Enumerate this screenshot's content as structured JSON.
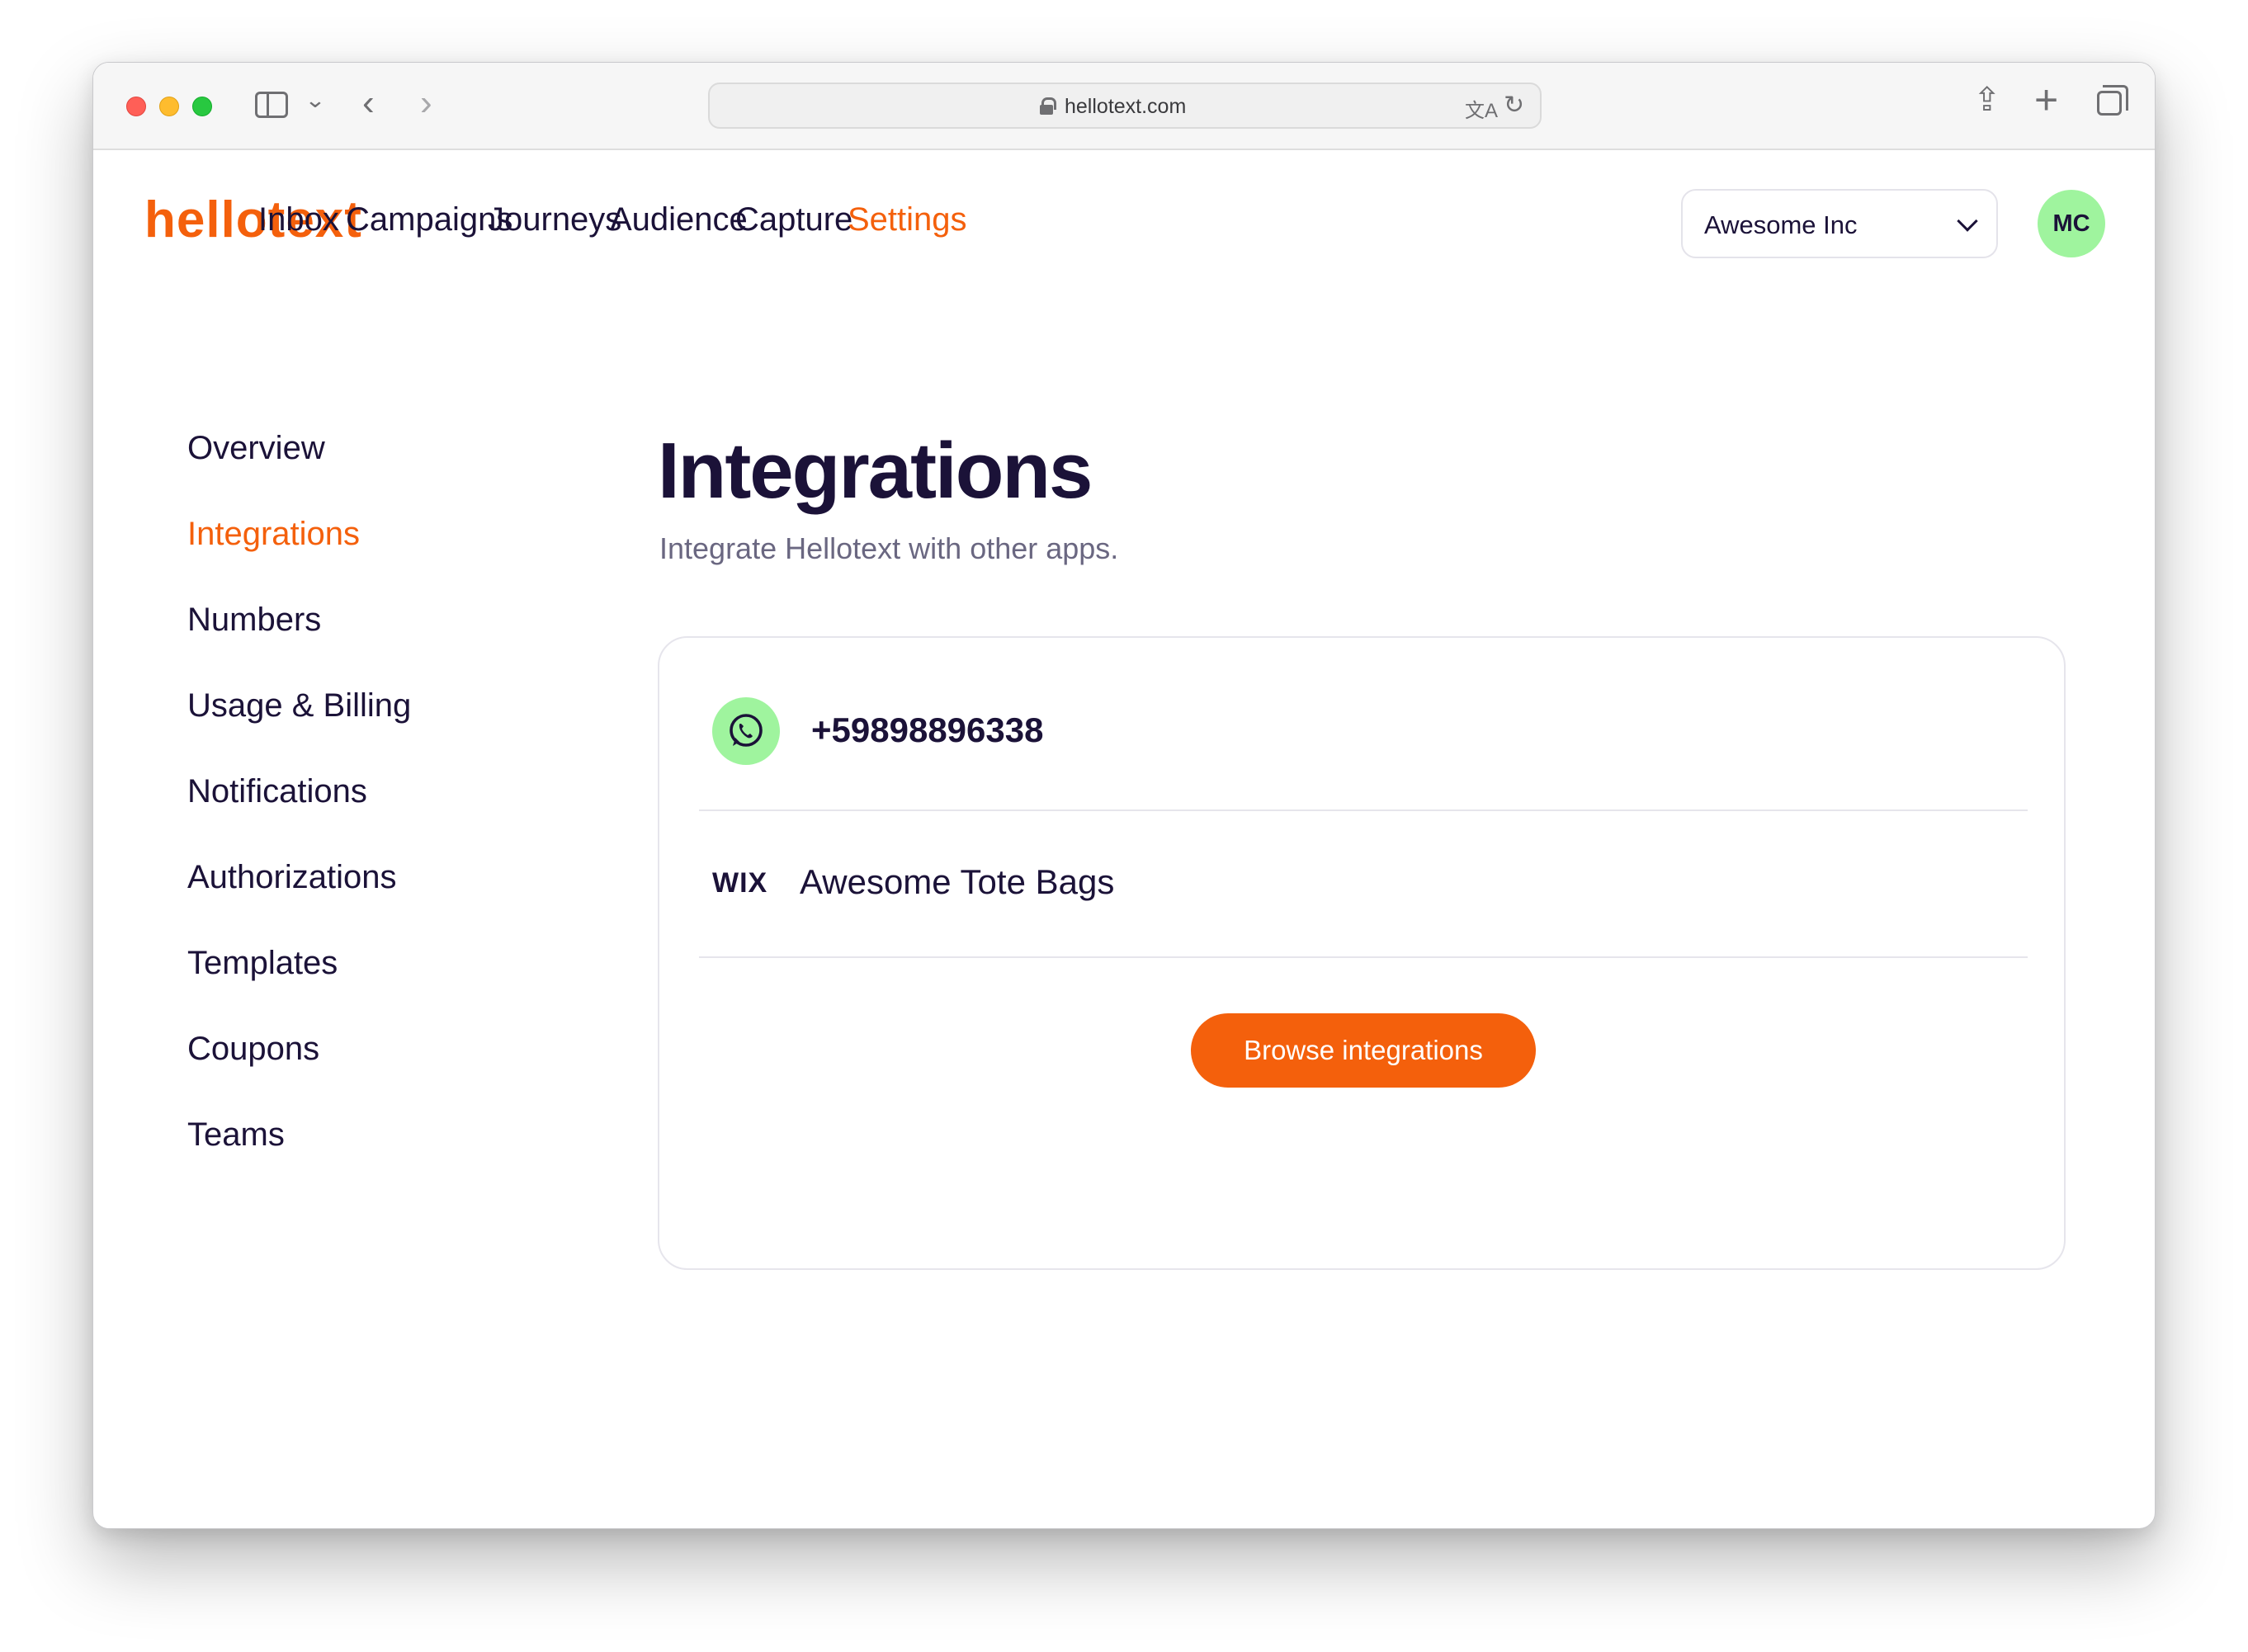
{
  "browser": {
    "url": "hellotext.com",
    "icons": [
      "close-dot",
      "minimize-dot",
      "zoom-dot",
      "sidebar-icon",
      "chevron-down-icon",
      "back-arrow-icon",
      "forward-arrow-icon",
      "lock-icon",
      "translate-icon",
      "reload-icon",
      "share-icon",
      "new-tab-icon",
      "tab-overview-icon"
    ]
  },
  "header": {
    "logo": "hellotext",
    "nav": [
      "Inbox",
      "Campaigns",
      "Journeys",
      "Audience",
      "Capture",
      "Settings"
    ],
    "active_nav": "Settings",
    "org_selector": "Awesome Inc",
    "avatar_initials": "MC"
  },
  "sidebar": {
    "items": [
      "Overview",
      "Integrations",
      "Numbers",
      "Usage & Billing",
      "Notifications",
      "Authorizations",
      "Templates",
      "Coupons",
      "Teams"
    ],
    "active": "Integrations"
  },
  "main": {
    "title": "Integrations",
    "subtitle": "Integrate Hellotext with other apps.",
    "integrations": [
      {
        "icon": "whatsapp-icon",
        "label": "+59898896338"
      },
      {
        "icon": "wix-logo",
        "logo_text": "WIX",
        "label": "Awesome Tote Bags"
      }
    ],
    "browse_button": "Browse integrations"
  },
  "colors": {
    "brand_orange": "#f4600c",
    "text_dark": "#1b1238",
    "accent_green": "#9ff49e"
  }
}
